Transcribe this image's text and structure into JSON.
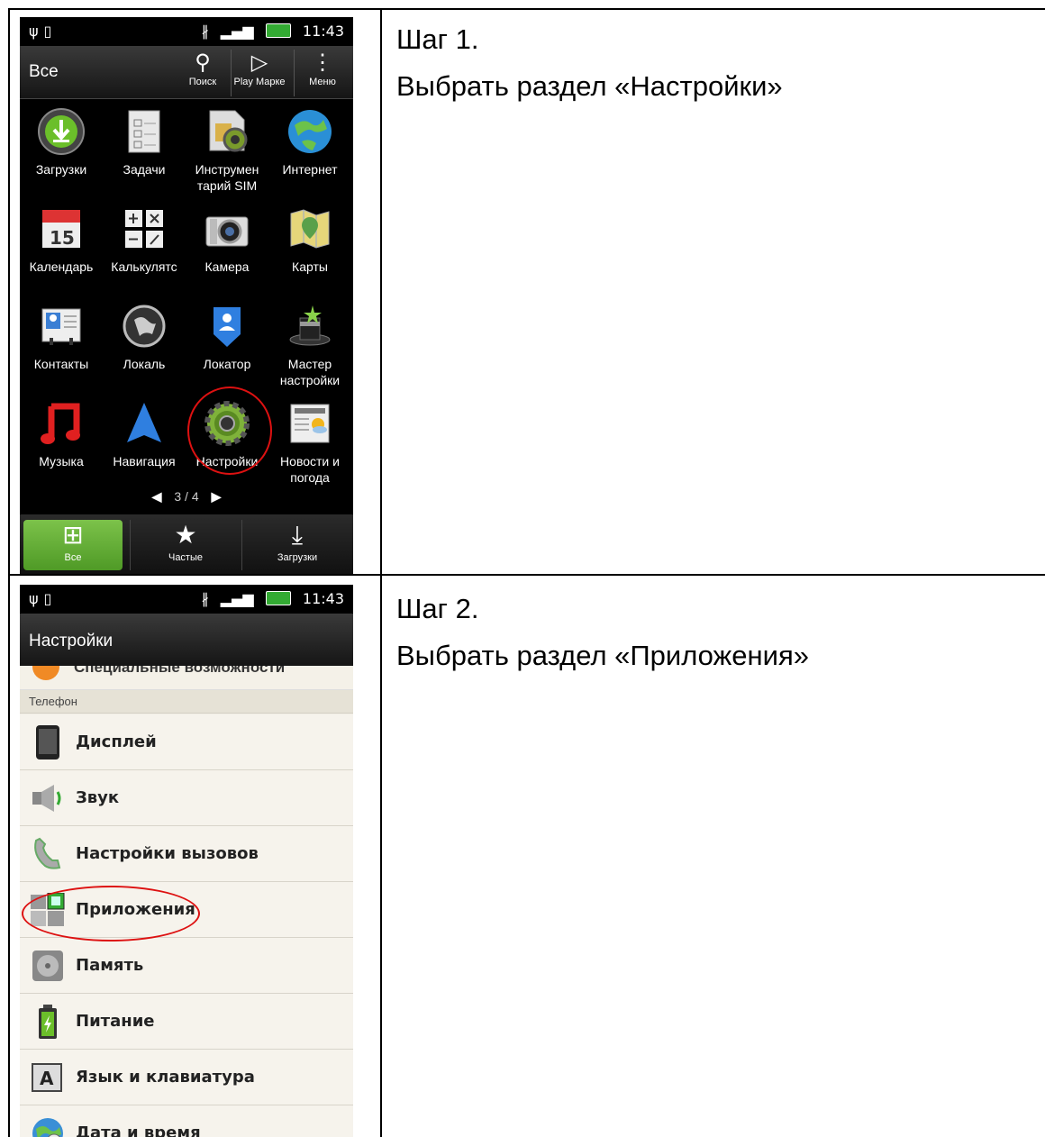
{
  "steps": [
    {
      "title": "Шаг 1.",
      "text": "Выбрать раздел «Настройки»"
    },
    {
      "title": "Шаг 2.",
      "text": "Выбрать раздел «Приложения»"
    }
  ],
  "status_bar": {
    "time": "11:43"
  },
  "screen1": {
    "title": "Все",
    "actions": [
      {
        "label": "Поиск",
        "icon": "search-icon"
      },
      {
        "label": "Play Марке",
        "icon": "play-store-icon"
      },
      {
        "label": "Меню",
        "icon": "menu-icon"
      }
    ],
    "apps": [
      {
        "label": "Загрузки",
        "icon": "download-icon"
      },
      {
        "label": "Задачи",
        "icon": "tasks-icon"
      },
      {
        "label": "Инструмен тарий SIM",
        "icon": "sim-toolkit-icon"
      },
      {
        "label": "Интернет",
        "icon": "globe-icon"
      },
      {
        "label": "Календарь",
        "icon": "calendar-icon"
      },
      {
        "label": "Калькулятс",
        "icon": "calculator-icon"
      },
      {
        "label": "Камера",
        "icon": "camera-icon"
      },
      {
        "label": "Карты",
        "icon": "maps-icon"
      },
      {
        "label": "Контакты",
        "icon": "contacts-icon"
      },
      {
        "label": "Локаль",
        "icon": "locale-icon"
      },
      {
        "label": "Локатор",
        "icon": "locator-icon"
      },
      {
        "label": "Мастер настройки",
        "icon": "setup-wizard-icon"
      },
      {
        "label": "Музыка",
        "icon": "music-icon"
      },
      {
        "label": "Навигация",
        "icon": "navigation-icon"
      },
      {
        "label": "Настройки",
        "icon": "settings-gear-icon"
      },
      {
        "label": "Новости и погода",
        "icon": "news-weather-icon"
      }
    ],
    "pager": "3 / 4",
    "dock": [
      {
        "label": "Все",
        "icon": "grid-icon",
        "active": true
      },
      {
        "label": "Частые",
        "icon": "star-icon",
        "active": false
      },
      {
        "label": "Загрузки",
        "icon": "download-arrow-icon",
        "active": false
      }
    ]
  },
  "screen2": {
    "title": "Настройки",
    "cut_item": "Специальные возможности",
    "section": "Телефон",
    "items": [
      {
        "label": "Дисплей",
        "icon": "phone-display-icon"
      },
      {
        "label": "Звук",
        "icon": "speaker-icon"
      },
      {
        "label": "Настройки вызовов",
        "icon": "call-handset-icon"
      },
      {
        "label": "Приложения",
        "icon": "apps-grid-icon"
      },
      {
        "label": "Память",
        "icon": "storage-disk-icon"
      },
      {
        "label": "Питание",
        "icon": "battery-icon"
      },
      {
        "label": "Язык и клавиатура",
        "icon": "keyboard-a-icon"
      },
      {
        "label": "Дата и время",
        "icon": "globe-clock-icon"
      }
    ]
  },
  "colors": {
    "highlight_ring": "#dd1111",
    "dock_active": "#6aaf3a"
  }
}
